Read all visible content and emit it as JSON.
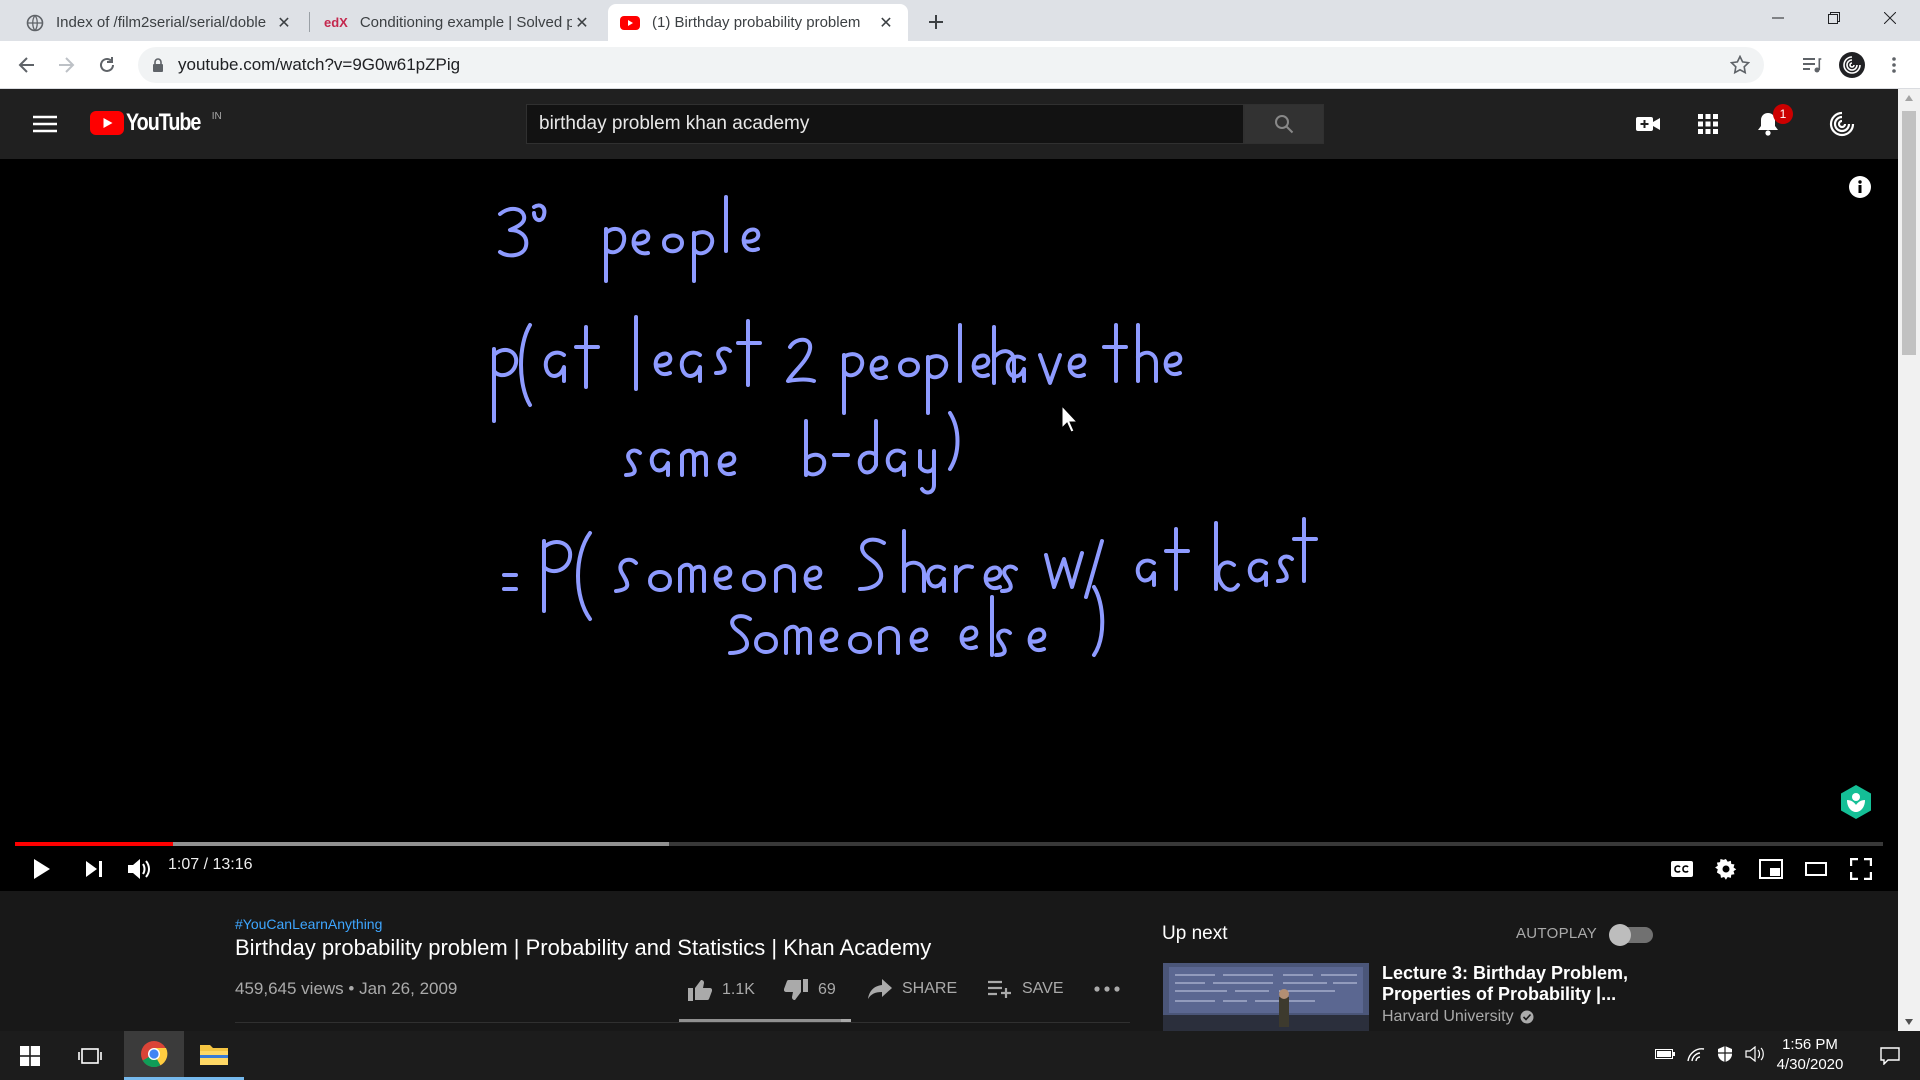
{
  "browser": {
    "tabs": [
      {
        "title": "Index of /film2serial/serial/doble",
        "icon": "globe-icon"
      },
      {
        "title": "Conditioning example | Solved pr",
        "icon": "edx-icon"
      },
      {
        "title": "(1) Birthday probability problem",
        "icon": "youtube-icon",
        "active": true
      }
    ],
    "url": "youtube.com/watch?v=9G0w61pZPig",
    "edx_favicon": "edX"
  },
  "youtube": {
    "logo_text": "YouTube",
    "region": "IN",
    "search_value": "birthday problem khan academy",
    "notification_count": "1"
  },
  "player": {
    "time": "1:07 / 13:16",
    "played_fraction": 0.0848,
    "loaded_fraction": 0.35,
    "board_lines": [
      "30 people",
      "p(at least 2 people have the",
      "same b-day)",
      "= P(someone shares w/ at least",
      "someone else)"
    ]
  },
  "video": {
    "hashtag": "#YouCanLearnAnything",
    "title": "Birthday probability problem | Probability and Statistics | Khan Academy",
    "views_date": "459,645 views • Jan 26, 2009",
    "likes": "1.1K",
    "dislikes": "69",
    "share_label": "SHARE",
    "save_label": "SAVE",
    "like_ratio": 0.94
  },
  "sidebar": {
    "up_next": "Up next",
    "autoplay": "AUTOPLAY",
    "autoplay_on": false,
    "rec_title": "Lecture 3: Birthday Problem, Properties of Probability |...",
    "rec_channel": "Harvard University"
  },
  "taskbar": {
    "time": "1:56 PM",
    "date": "4/30/2020"
  },
  "colors": {
    "accent_red": "#ff0000",
    "link_blue": "#3ea6ff",
    "chalk": "#8e9bff"
  }
}
